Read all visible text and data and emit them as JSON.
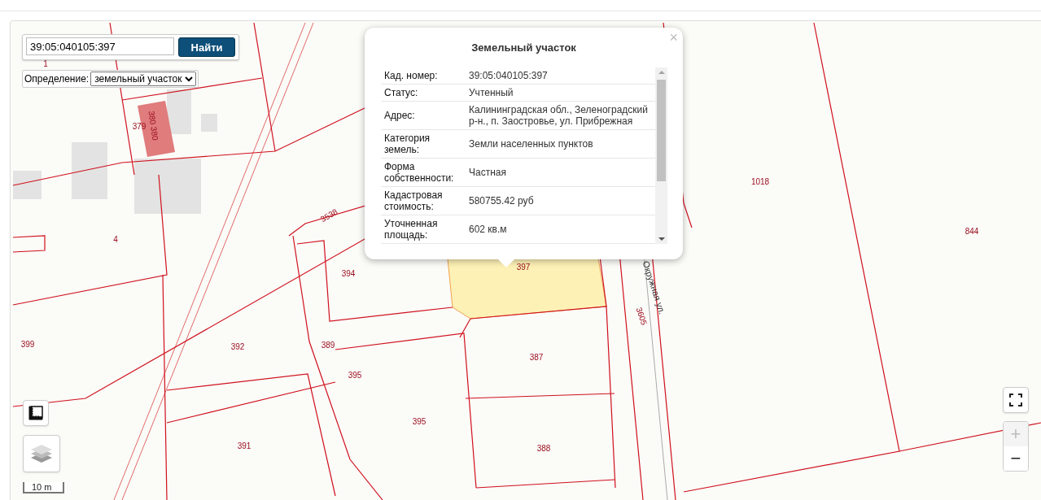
{
  "search": {
    "value": "39:05:040105:397",
    "button": "Найти"
  },
  "definition": {
    "label": "Определение:",
    "value": "земельный участок"
  },
  "map": {
    "labels": [
      {
        "text": "1",
        "kind": "parcel"
      },
      {
        "text": "379",
        "kind": "parcel"
      },
      {
        "text": "380 380",
        "kind": "building"
      },
      {
        "text": "4",
        "kind": "parcel"
      },
      {
        "text": "3538",
        "kind": "parcel"
      },
      {
        "text": "394",
        "kind": "parcel"
      },
      {
        "text": "397",
        "kind": "parcel"
      },
      {
        "text": "399",
        "kind": "parcel"
      },
      {
        "text": "392",
        "kind": "parcel"
      },
      {
        "text": "389",
        "kind": "parcel"
      },
      {
        "text": "395",
        "kind": "parcel"
      },
      {
        "text": "387",
        "kind": "parcel"
      },
      {
        "text": "395",
        "kind": "parcel"
      },
      {
        "text": "391",
        "kind": "parcel"
      },
      {
        "text": "388",
        "kind": "parcel"
      },
      {
        "text": "1018",
        "kind": "parcel"
      },
      {
        "text": "844",
        "kind": "parcel"
      },
      {
        "text": "3605",
        "kind": "parcel"
      },
      {
        "text": "Окружная ул.",
        "kind": "street"
      }
    ],
    "scale": "10 m"
  },
  "popup": {
    "title": "Земельный участок",
    "close": "×",
    "rows": [
      {
        "label": "Кад. номер:",
        "value": "39:05:040105:397"
      },
      {
        "label": "Статус:",
        "value": "Учтенный"
      },
      {
        "label": "Адрес:",
        "value": "Калининградская обл., Зеленоградский р-н., п. Заостровье, ул. Прибрежная"
      },
      {
        "label": "Категория земель:",
        "value": "Земли населенных пунктов"
      },
      {
        "label": "Форма собственности:",
        "value": "Частная"
      },
      {
        "label": "Кадастровая стоимость:",
        "value": "580755.42 руб"
      },
      {
        "label": "Уточненная площадь:",
        "value": "602 кв.м"
      }
    ]
  },
  "zoom": [
    {
      "label": "+",
      "disabled": true
    },
    {
      "label": "−",
      "disabled": false
    }
  ]
}
